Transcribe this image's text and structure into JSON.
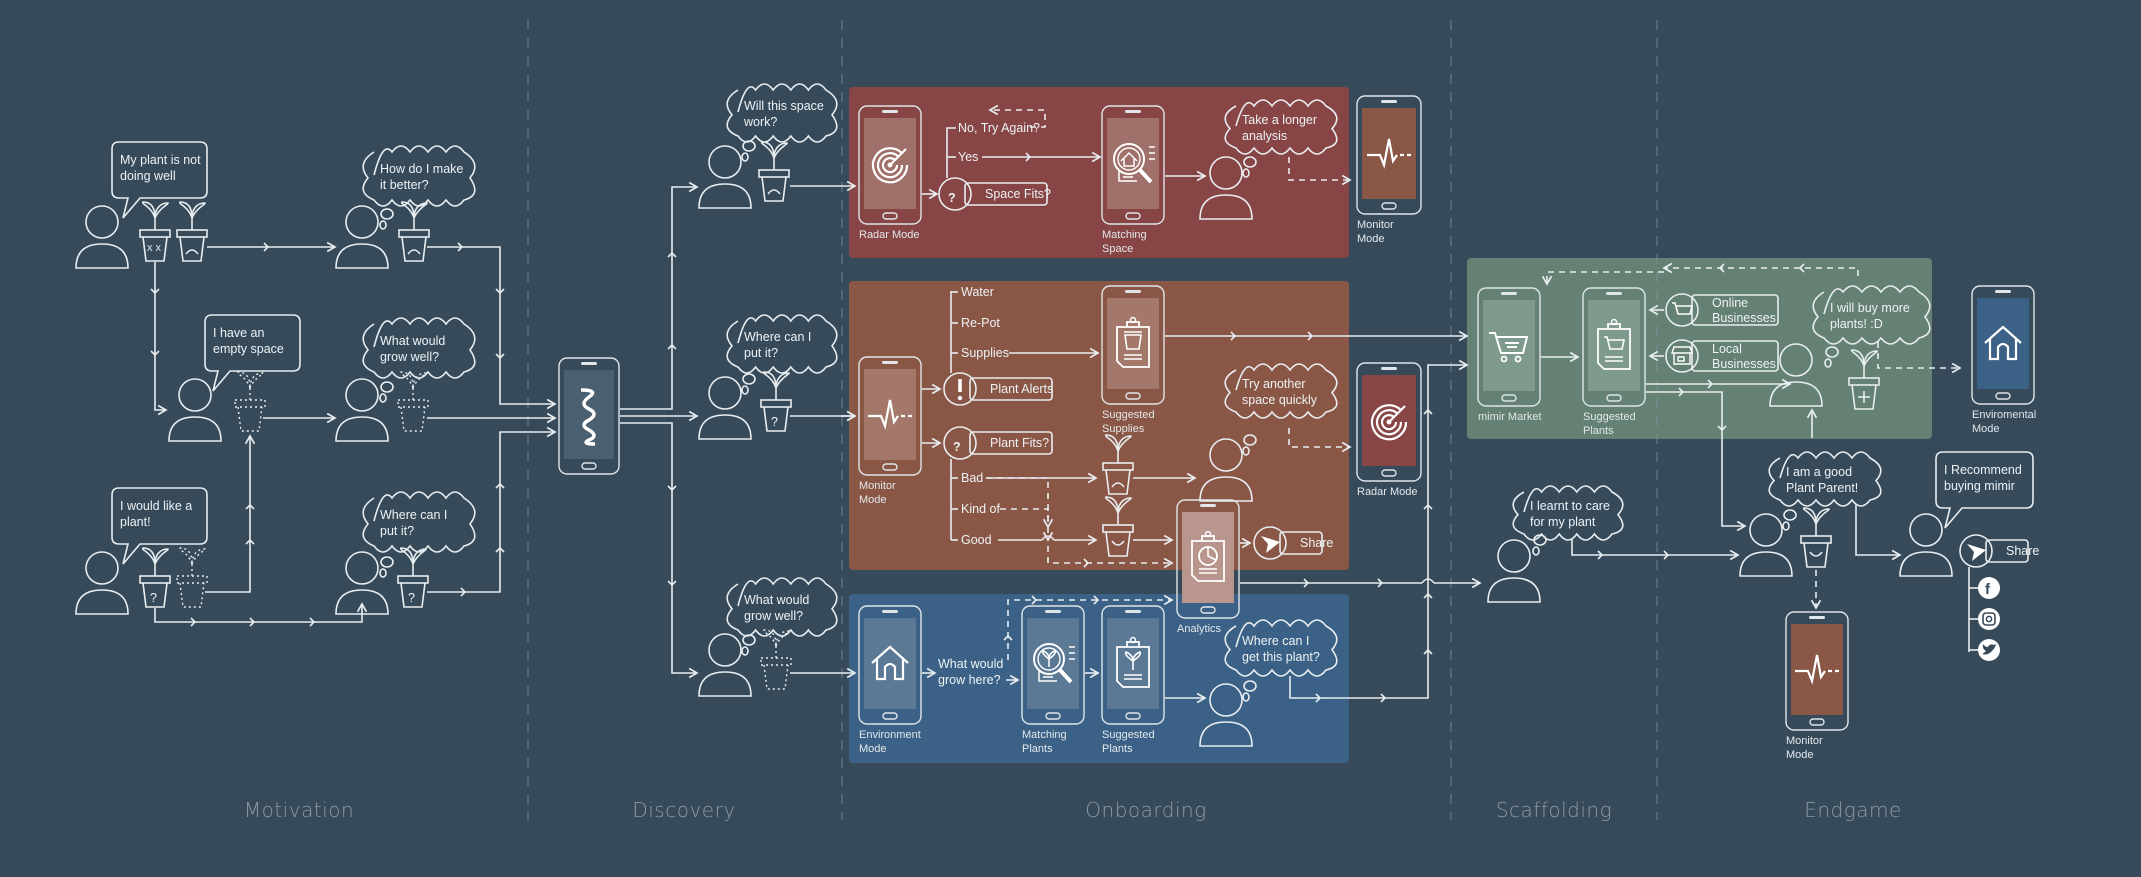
{
  "colors": {
    "background": "#364a5a",
    "radar_section": "#874545",
    "monitor_section": "#8a5746",
    "environment_section": "#3b6186",
    "market_section": "#648174",
    "line": "#e8edf0",
    "phase_label": "#8d9aa4"
  },
  "phases": [
    "Motivation",
    "Discovery",
    "Onboarding",
    "Scaffolding",
    "Endgame"
  ],
  "motivation": {
    "bubbles": {
      "not_well": [
        "My plant is not",
        "doing well"
      ],
      "make_better": [
        "How do I make",
        "it better?"
      ],
      "empty_space": [
        "I have an",
        "empty space"
      ],
      "grow_well": [
        "What would",
        "grow well?"
      ],
      "like_plant": [
        "I would like a",
        "plant!"
      ],
      "put_it": [
        "Where can I",
        "put it?"
      ]
    }
  },
  "discovery": {
    "app_name": "mimir",
    "bubbles": {
      "space_work": [
        "Will this space",
        "work?"
      ],
      "put_it": [
        "Where can I",
        "put it?"
      ],
      "grow_well": [
        "What would",
        "grow well?"
      ]
    }
  },
  "onboarding": {
    "radar": {
      "phone_label": [
        "Radar Mode"
      ],
      "badge": "Space Fits?",
      "options": [
        "No, Try Again?",
        "Yes"
      ],
      "matching_label": [
        "Matching",
        "Space"
      ],
      "bubble": [
        "Take a longer",
        "analysis"
      ],
      "next_label": [
        "Monitor",
        "Mode"
      ]
    },
    "monitor": {
      "phone_label": [
        "Monitor",
        "Mode"
      ],
      "alerts_badge": "Plant Alerts",
      "alert_options": [
        "Water",
        "Re-Pot",
        "Supplies"
      ],
      "fits_badge": "Plant Fits?",
      "fit_options": [
        "Bad",
        "Kind of",
        "Good"
      ],
      "supplies_label": [
        "Suggested",
        "Supplies"
      ],
      "bubble": [
        "Try another",
        "space quickly"
      ],
      "next_label": [
        "Radar Mode"
      ],
      "analytics_label": "Analytics",
      "share_label": "Share"
    },
    "environment": {
      "phone_label": [
        "Environment",
        "Mode"
      ],
      "question": [
        "What would",
        "grow here?"
      ],
      "matching_label": [
        "Matching",
        "Plants"
      ],
      "suggested_label": [
        "Suggested",
        "Plants"
      ],
      "bubble": [
        "Where can I",
        "get this plant?"
      ]
    }
  },
  "scaffolding": {
    "market_label": [
      "mimir Market"
    ],
    "suggested_label": [
      "Suggested",
      "Plants"
    ],
    "online_badge": [
      "Online",
      "Businesses"
    ],
    "local_badge": [
      "Local",
      "Businesses"
    ],
    "learnt_bubble": [
      "I learnt to care",
      "for my plant"
    ]
  },
  "endgame": {
    "buy_bubble": [
      "I will buy more",
      "plants! :D"
    ],
    "good_parent_bubble": [
      "I am a good",
      "Plant Parent!"
    ],
    "recommend_bubble": [
      "I  Recommend",
      "buying mimir"
    ],
    "share_label": "Share",
    "social": [
      "facebook",
      "instagram",
      "twitter"
    ],
    "env_label": [
      "Enviromental",
      "Mode"
    ],
    "monitor_label": [
      "Monitor",
      "Mode"
    ]
  }
}
